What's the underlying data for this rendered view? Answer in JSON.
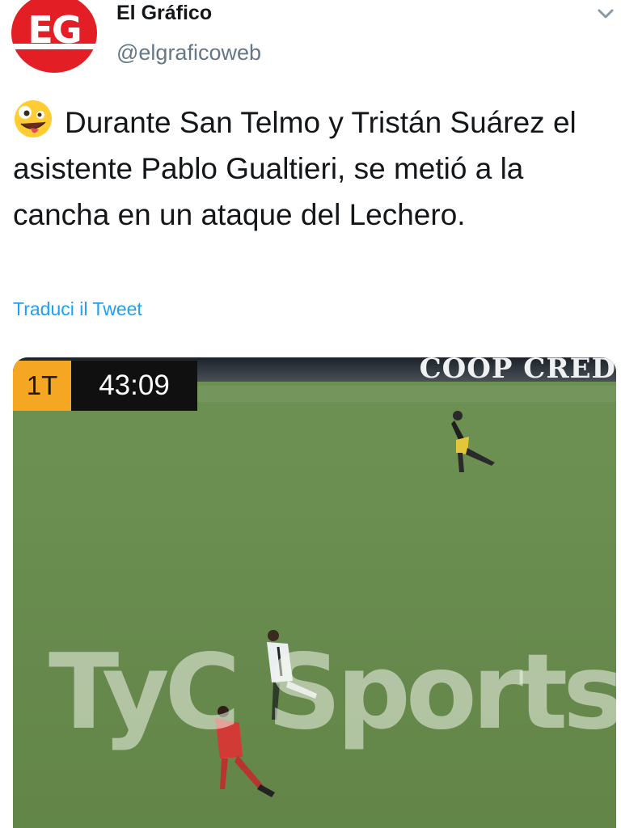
{
  "account": {
    "avatar_text": "EG",
    "display_name": "El Gráfico",
    "handle": "@elgraficoweb"
  },
  "tweet": {
    "emoji_name": "zany-face-emoji",
    "text": "Durante San Telmo y Tristán Suárez el asistente Pablo Gualtieri, se metió a la cancha en un ataque del Lechero.",
    "translate_label": "Traduci il Tweet"
  },
  "media": {
    "scoreboard": {
      "half": "1T",
      "time": "43:09"
    },
    "banner_text": "COOP CRED",
    "watermark": "TyC Sports"
  },
  "colors": {
    "link": "#1da1f2",
    "brand_red": "#e31e24",
    "scoreboard_orange": "#f5a623",
    "pitch_green": "#6a8f50"
  }
}
